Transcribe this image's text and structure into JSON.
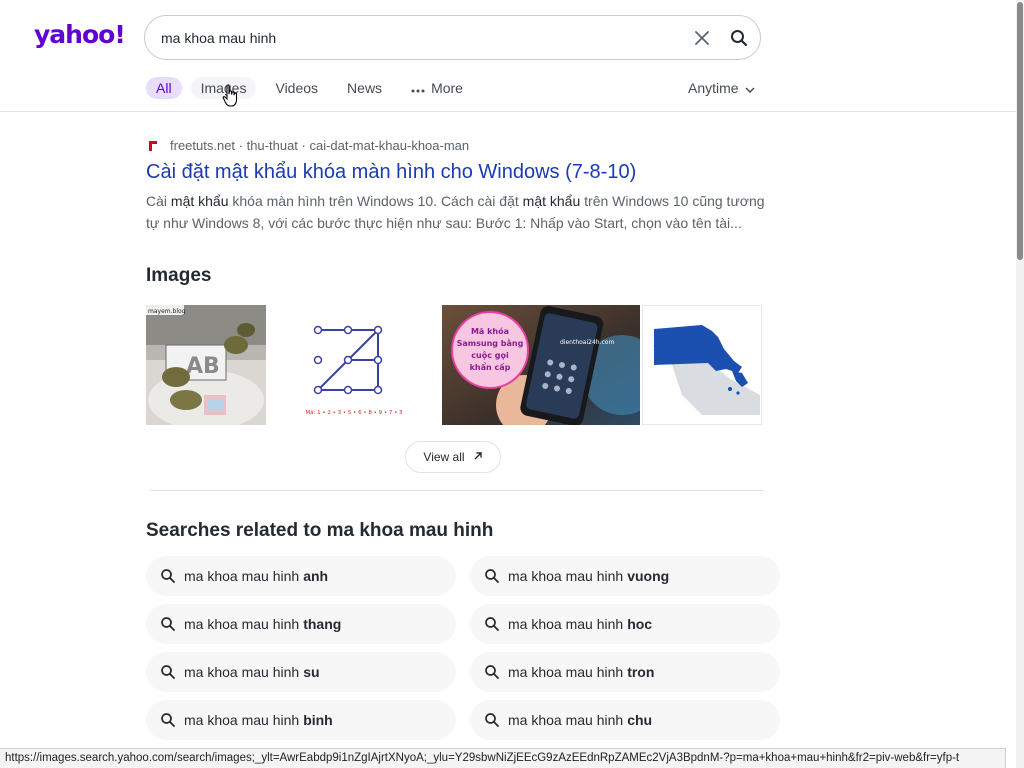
{
  "logo": "yahoo!",
  "search": {
    "value": "ma khoa mau hinh",
    "clear_icon": "close-icon",
    "search_icon": "search-icon"
  },
  "tabs": [
    {
      "label": "All",
      "active": true
    },
    {
      "label": "Images",
      "active": false
    },
    {
      "label": "Videos",
      "active": false
    },
    {
      "label": "News",
      "active": false
    },
    {
      "label": "More",
      "active": false
    }
  ],
  "time_filter": "Anytime",
  "result": {
    "source": "freetuts.net · thu-thuat · cai-dat-mat-khau-khoa-man",
    "title": "Cài đặt mật khẩu khóa màn hình cho Windows (7-8-10)",
    "snippet_parts": [
      {
        "text": "Cài ",
        "bold": false
      },
      {
        "text": "mật khẩu",
        "bold": true
      },
      {
        "text": " khóa màn hình trên Windows 10. Cách cài đặt ",
        "bold": false
      },
      {
        "text": "mật khẩu",
        "bold": true
      },
      {
        "text": " trên Windows 10 cũng tương tự như Windows 8, với các bước thực hiện như sau: Bước 1: Nhấp vào Start, chọn vào tên tài...",
        "bold": false
      }
    ]
  },
  "images_section": {
    "heading": "Images",
    "view_all": "View all",
    "thumb_texts": {
      "samsung_caption_1": "Mã khóa",
      "samsung_caption_2": "Samsung bằng",
      "samsung_caption_3": "cuộc gọi",
      "samsung_caption_4": "khẩn cấp",
      "samsung_watermark": "dienthoai24h.com",
      "pattern_caption": "Mã: 1 • 2 • 3 • 5 • 6 • 8 • 9 • 7 • 3",
      "photo_tag": "mayem.blog"
    }
  },
  "related": {
    "heading": "Searches related to ma khoa mau hinh",
    "prefix": "ma khoa mau hinh",
    "items": [
      {
        "suffix": "anh"
      },
      {
        "suffix": "vuong"
      },
      {
        "suffix": "thang"
      },
      {
        "suffix": "hoc"
      },
      {
        "suffix": "su"
      },
      {
        "suffix": "tron"
      },
      {
        "suffix": "binh"
      },
      {
        "suffix": "chu"
      }
    ]
  },
  "status_url": "https://images.search.yahoo.com/search/images;_ylt=AwrEabdp9i1nZgIAjrtXNyoA;_ylu=Y29sbwNiZjEEcG9zAzEEdnRpZAMEc2VjA3BpdnM-?p=ma+khoa+mau+hinh&fr2=piv-web&fr=yfp-t",
  "colors": {
    "brand": "#6001d2",
    "link": "#1c3ab1",
    "active_tab_bg": "#e8dcfb"
  }
}
